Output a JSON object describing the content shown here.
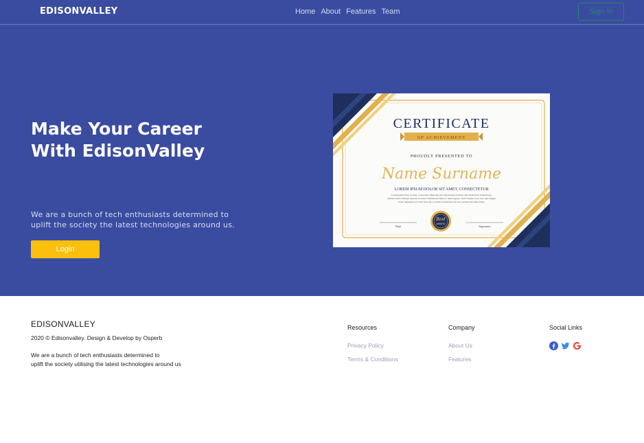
{
  "nav": {
    "brand": "EDISONVALLEY",
    "links": [
      "Home",
      "About",
      "Features",
      "Team"
    ],
    "signin_label": "Sign In"
  },
  "hero": {
    "headline_line1": "Make Your Career",
    "headline_line2": "With EdisonValley",
    "tagline_line1": "We are a bunch of tech enthusiasts determined to",
    "tagline_line2": "uplift the society the latest technologies around us.",
    "login_label": "Login"
  },
  "certificate": {
    "title": "CERTIFICATE",
    "subtitle": "OF ACHIEVEMENT",
    "presented": "PROUDLY PRESENTED TO",
    "name": "Name Surname",
    "lorem": "LOREM IPSUM DOLOR SIT AMET, CONSECTETUR",
    "body_text_line1": "Lorem ipsum dolor sit amet, consectetur adipiscing elit. Pellentesque facilisis sollicitudin nibh. Pellentesque",
    "body_text_line2": "habitant morbi tristique senectus et netus et malesuada fames ac turpis egestas. Nunc feugiat tortor eros, quis feugiat",
    "body_text_line3": "lorem dignissim sed. Nam vitae elit, convallis sollicitudin odio hac, pulvinar tincidunt massa",
    "date_label": "Date",
    "signature_label": "Signature",
    "badge_line1": "Best",
    "badge_line2": "AWARD"
  },
  "footer": {
    "brand": "EDISONVALLEY",
    "copyright": "2020 © Edisonvalley. Design & Develop by Osperb",
    "desc_line1": "We are a bunch of tech enthusiasts determined to",
    "desc_line2": "uplift the society utilising the latest technologies around us",
    "resources": {
      "heading": "Resources",
      "links": [
        "Privacy Policy",
        "Terms & Conditions"
      ]
    },
    "company": {
      "heading": "Company",
      "links": [
        "About Us",
        "Features"
      ]
    },
    "social": {
      "heading": "Social Links",
      "icons": [
        "facebook-icon",
        "twitter-icon",
        "google-icon"
      ]
    }
  },
  "colors": {
    "hero_bg": "#3a4ca0",
    "accent_yellow": "#fbbf0d",
    "signin_green": "#1f8a63",
    "cert_navy": "#1e2f5c",
    "cert_gold": "#e3b04b"
  }
}
